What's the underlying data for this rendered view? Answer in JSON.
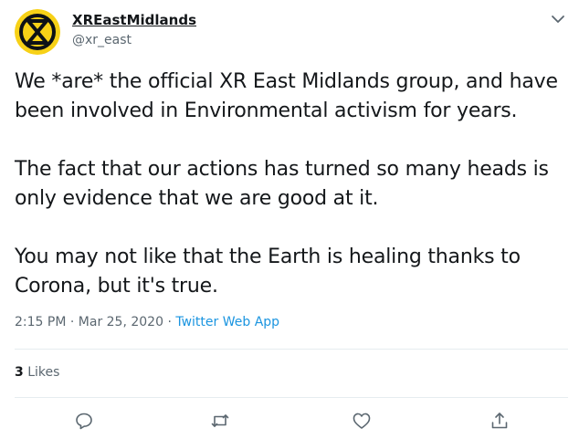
{
  "author": {
    "display_name": "XREastMidlands",
    "handle": "@xr_east",
    "avatar_icon": "extinction-symbol-icon"
  },
  "tweet": {
    "paragraphs": [
      [
        "We *are* the official XR East Midlands group, and have",
        "been involved in Environmental activism for years."
      ],
      [
        "The fact that our actions has turned so many heads is",
        "only evidence that we are good at it."
      ],
      [
        "You may not like that the Earth is healing thanks to",
        "Corona, but it's true."
      ]
    ],
    "time": "2:15 PM",
    "separator": "·",
    "date": "Mar 25, 2020",
    "source": "Twitter Web App"
  },
  "stats": {
    "likes_count": "3",
    "likes_label": "Likes"
  },
  "actions": [
    {
      "name": "reply",
      "icon": "reply-icon"
    },
    {
      "name": "retweet",
      "icon": "retweet-icon"
    },
    {
      "name": "like",
      "icon": "heart-icon"
    },
    {
      "name": "share",
      "icon": "share-icon"
    }
  ],
  "colors": {
    "text": "#14171a",
    "secondary": "#5b6770",
    "link": "#1b95e0",
    "avatar_bg": "#f7d117",
    "avatar_mark": "#0d1117",
    "divider": "#e6ecf0"
  }
}
